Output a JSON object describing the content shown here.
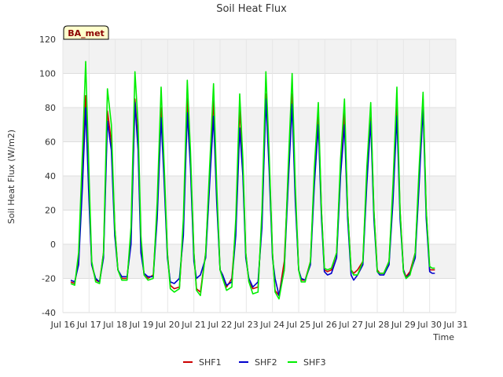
{
  "chart_data": {
    "type": "line",
    "title": "Soil Heat Flux",
    "xlabel": "Time",
    "ylabel": "Soil Heat Flux (W/m2)",
    "badge": "BA_met",
    "xlim": [
      16,
      31
    ],
    "ylim": [
      -40,
      120
    ],
    "x_ticks": [
      16,
      17,
      18,
      19,
      20,
      21,
      22,
      23,
      24,
      25,
      26,
      27,
      28,
      29,
      30,
      31
    ],
    "x_tick_labels": [
      "Jul 16",
      "Jul 17",
      "Jul 18",
      "Jul 19",
      "Jul 20",
      "Jul 21",
      "Jul 22",
      "Jul 23",
      "Jul 24",
      "Jul 25",
      "Jul 26",
      "Jul 27",
      "Jul 28",
      "Jul 29",
      "Jul 30",
      "Jul 31"
    ],
    "y_ticks": [
      -40,
      -20,
      0,
      20,
      40,
      60,
      80,
      100,
      120
    ],
    "y_tick_labels": [
      "-40",
      "-20",
      "0",
      "20",
      "40",
      "60",
      "80",
      "100",
      "120"
    ],
    "grid": true,
    "legend_position": "bottom-center",
    "series": [
      {
        "name": "SHF1",
        "color": "#cc0000",
        "x": [
          16.3,
          16.45,
          16.6,
          16.75,
          16.87,
          17.0,
          17.1,
          17.25,
          17.4,
          17.55,
          17.7,
          17.85,
          17.98,
          18.1,
          18.25,
          18.45,
          18.6,
          18.75,
          18.87,
          18.98,
          19.1,
          19.25,
          19.45,
          19.6,
          19.75,
          19.87,
          19.99,
          20.1,
          20.25,
          20.45,
          20.6,
          20.75,
          20.87,
          21.0,
          21.1,
          21.25,
          21.45,
          21.6,
          21.75,
          21.87,
          22.0,
          22.1,
          22.25,
          22.45,
          22.6,
          22.75,
          22.87,
          22.98,
          23.1,
          23.25,
          23.45,
          23.6,
          23.75,
          23.87,
          24.0,
          24.1,
          24.25,
          24.45,
          24.6,
          24.75,
          24.87,
          25.0,
          25.1,
          25.25,
          25.45,
          25.6,
          25.75,
          25.87,
          25.98,
          26.1,
          26.25,
          26.45,
          26.6,
          26.75,
          26.87,
          27.0,
          27.1,
          27.25,
          27.45,
          27.6,
          27.75,
          27.87,
          28.0,
          28.1,
          28.25,
          28.45,
          28.6,
          28.75,
          28.87,
          29.0,
          29.1,
          29.25,
          29.45,
          29.6,
          29.75,
          29.87,
          30.0,
          30.1,
          30.2
        ],
        "y": [
          -22,
          -23,
          -10,
          45,
          87,
          30,
          -12,
          -21,
          -22,
          -5,
          78,
          60,
          10,
          -15,
          -20,
          -20,
          5,
          85,
          60,
          0,
          -18,
          -20,
          -18,
          20,
          80,
          40,
          -5,
          -24,
          -26,
          -25,
          10,
          86,
          50,
          -5,
          -26,
          -28,
          -5,
          40,
          85,
          30,
          -15,
          -18,
          -25,
          -20,
          10,
          80,
          45,
          -5,
          -22,
          -26,
          -25,
          15,
          88,
          50,
          -5,
          -27,
          -30,
          -10,
          40,
          88,
          30,
          -15,
          -21,
          -21,
          -10,
          40,
          76,
          20,
          -15,
          -16,
          -15,
          -5,
          45,
          78,
          20,
          -15,
          -17,
          -15,
          -10,
          40,
          78,
          20,
          -15,
          -17,
          -17,
          -10,
          30,
          80,
          20,
          -15,
          -19,
          -16,
          -5,
          40,
          85,
          20,
          -15,
          -15,
          -15
        ]
      },
      {
        "name": "SHF2",
        "color": "#0000cc",
        "x": [
          16.3,
          16.45,
          16.6,
          16.75,
          16.87,
          17.0,
          17.1,
          17.25,
          17.4,
          17.55,
          17.7,
          17.85,
          17.98,
          18.1,
          18.25,
          18.45,
          18.6,
          18.75,
          18.87,
          18.98,
          19.1,
          19.25,
          19.45,
          19.6,
          19.75,
          19.87,
          19.99,
          20.1,
          20.25,
          20.45,
          20.6,
          20.75,
          20.87,
          21.0,
          21.1,
          21.25,
          21.45,
          21.6,
          21.75,
          21.87,
          22.0,
          22.1,
          22.25,
          22.45,
          22.6,
          22.75,
          22.87,
          22.98,
          23.1,
          23.25,
          23.45,
          23.6,
          23.75,
          23.87,
          24.0,
          24.1,
          24.25,
          24.45,
          24.6,
          24.75,
          24.87,
          25.0,
          25.1,
          25.25,
          25.45,
          25.6,
          25.75,
          25.87,
          25.98,
          26.1,
          26.25,
          26.45,
          26.6,
          26.75,
          26.87,
          27.0,
          27.1,
          27.25,
          27.45,
          27.6,
          27.75,
          27.87,
          28.0,
          28.1,
          28.25,
          28.45,
          28.6,
          28.75,
          28.87,
          29.0,
          29.1,
          29.25,
          29.45,
          29.6,
          29.75,
          29.87,
          30.0,
          30.1,
          30.2
        ],
        "y": [
          -21,
          -22,
          -12,
          35,
          80,
          25,
          -12,
          -20,
          -22,
          -8,
          72,
          55,
          5,
          -15,
          -19,
          -19,
          0,
          83,
          55,
          -5,
          -17,
          -19,
          -19,
          15,
          74,
          35,
          -8,
          -22,
          -23,
          -20,
          5,
          77,
          45,
          -10,
          -20,
          -18,
          -8,
          35,
          75,
          25,
          -15,
          -18,
          -24,
          -22,
          5,
          68,
          40,
          -8,
          -20,
          -25,
          -22,
          10,
          85,
          45,
          -8,
          -20,
          -30,
          -15,
          35,
          82,
          25,
          -15,
          -20,
          -21,
          -12,
          35,
          70,
          15,
          -16,
          -18,
          -17,
          -8,
          40,
          70,
          15,
          -18,
          -21,
          -18,
          -12,
          35,
          72,
          15,
          -16,
          -18,
          -18,
          -12,
          25,
          75,
          15,
          -15,
          -20,
          -17,
          -8,
          35,
          80,
          15,
          -16,
          -17,
          -17
        ]
      },
      {
        "name": "SHF3",
        "color": "#00ee00",
        "x": [
          16.3,
          16.45,
          16.6,
          16.75,
          16.87,
          17.0,
          17.1,
          17.25,
          17.4,
          17.55,
          17.7,
          17.85,
          17.98,
          18.1,
          18.25,
          18.45,
          18.6,
          18.75,
          18.87,
          18.98,
          19.1,
          19.25,
          19.45,
          19.6,
          19.75,
          19.87,
          19.99,
          20.1,
          20.25,
          20.45,
          20.6,
          20.75,
          20.87,
          21.0,
          21.1,
          21.25,
          21.45,
          21.6,
          21.75,
          21.87,
          22.0,
          22.1,
          22.25,
          22.45,
          22.6,
          22.75,
          22.87,
          22.98,
          23.1,
          23.25,
          23.45,
          23.6,
          23.75,
          23.87,
          24.0,
          24.1,
          24.25,
          24.45,
          24.6,
          24.75,
          24.87,
          25.0,
          25.1,
          25.25,
          25.45,
          25.6,
          25.75,
          25.87,
          25.98,
          26.1,
          26.25,
          26.45,
          26.6,
          26.75,
          26.87,
          27.0,
          27.1,
          27.25,
          27.45,
          27.6,
          27.75,
          27.87,
          28.0,
          28.1,
          28.25,
          28.45,
          28.6,
          28.75,
          28.87,
          29.0,
          29.1,
          29.25,
          29.45,
          29.6,
          29.75,
          29.87,
          30.0,
          30.1,
          30.2
        ],
        "y": [
          -23,
          -24,
          -5,
          55,
          107,
          40,
          -10,
          -22,
          -23,
          -5,
          91,
          70,
          10,
          -15,
          -21,
          -21,
          10,
          101,
          70,
          5,
          -18,
          -21,
          -20,
          25,
          92,
          45,
          -5,
          -26,
          -28,
          -26,
          15,
          96,
          55,
          -5,
          -27,
          -30,
          -5,
          45,
          94,
          35,
          -15,
          -20,
          -27,
          -25,
          15,
          88,
          50,
          -5,
          -22,
          -29,
          -28,
          20,
          101,
          55,
          -5,
          -28,
          -32,
          -15,
          45,
          100,
          35,
          -15,
          -22,
          -22,
          -10,
          45,
          83,
          20,
          -14,
          -15,
          -14,
          -5,
          50,
          85,
          20,
          -15,
          -18,
          -18,
          -10,
          45,
          83,
          20,
          -16,
          -17,
          -17,
          -10,
          35,
          92,
          20,
          -16,
          -20,
          -18,
          -5,
          45,
          89,
          20,
          -13,
          -14,
          -14
        ]
      }
    ]
  }
}
